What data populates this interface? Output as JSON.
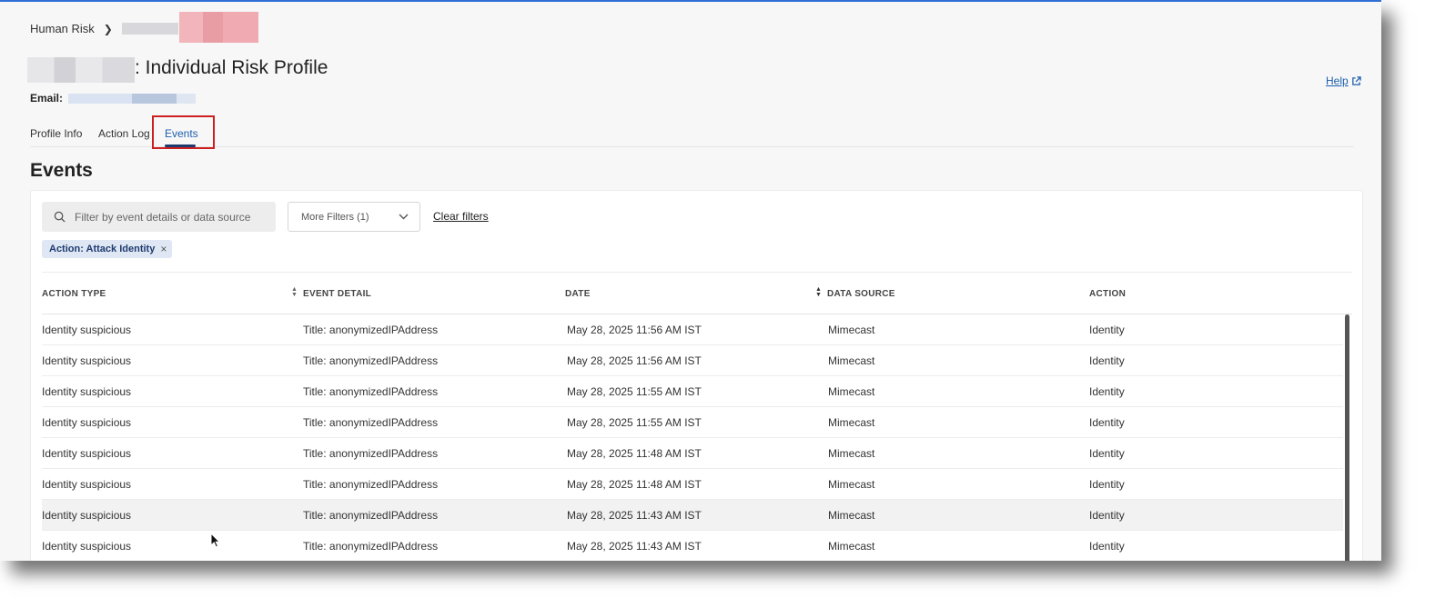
{
  "breadcrumb": {
    "root": "Human Risk"
  },
  "header": {
    "title_suffix": ": Individual Risk Profile",
    "email_label": "Email:",
    "help_label": "Help"
  },
  "tabs": [
    {
      "label": "Profile Info"
    },
    {
      "label": "Action Log"
    },
    {
      "label": "Events",
      "active": true
    }
  ],
  "section": {
    "title": "Events"
  },
  "filters": {
    "search_placeholder": "Filter by event details or data source",
    "more_filters_label": "More Filters (1)",
    "clear_label": "Clear filters",
    "chip_label": "Action: Attack Identity"
  },
  "table": {
    "columns": [
      "ACTION TYPE",
      "EVENT DETAIL",
      "DATE",
      "DATA SOURCE",
      "ACTION"
    ],
    "rows": [
      [
        "Identity suspicious",
        "Title: anonymizedIPAddress",
        "May 28, 2025 11:56 AM IST",
        "Mimecast",
        "Identity"
      ],
      [
        "Identity suspicious",
        "Title: anonymizedIPAddress",
        "May 28, 2025 11:56 AM IST",
        "Mimecast",
        "Identity"
      ],
      [
        "Identity suspicious",
        "Title: anonymizedIPAddress",
        "May 28, 2025 11:55 AM IST",
        "Mimecast",
        "Identity"
      ],
      [
        "Identity suspicious",
        "Title: anonymizedIPAddress",
        "May 28, 2025 11:55 AM IST",
        "Mimecast",
        "Identity"
      ],
      [
        "Identity suspicious",
        "Title: anonymizedIPAddress",
        "May 28, 2025 11:48 AM IST",
        "Mimecast",
        "Identity"
      ],
      [
        "Identity suspicious",
        "Title: anonymizedIPAddress",
        "May 28, 2025 11:48 AM IST",
        "Mimecast",
        "Identity"
      ],
      [
        "Identity suspicious",
        "Title: anonymizedIPAddress",
        "May 28, 2025 11:43 AM IST",
        "Mimecast",
        "Identity"
      ],
      [
        "Identity suspicious",
        "Title: anonymizedIPAddress",
        "May 28, 2025 11:43 AM IST",
        "Mimecast",
        "Identity"
      ]
    ]
  },
  "colors": {
    "accent": "#1d5fae",
    "tab_underline": "#1e3a6e",
    "highlight_box": "#cc2020",
    "chip_bg": "#dfe7f4"
  },
  "icons": {
    "search": "search-icon",
    "chevron": "chevron-down-icon",
    "external": "external-link-icon",
    "close": "close-icon"
  }
}
